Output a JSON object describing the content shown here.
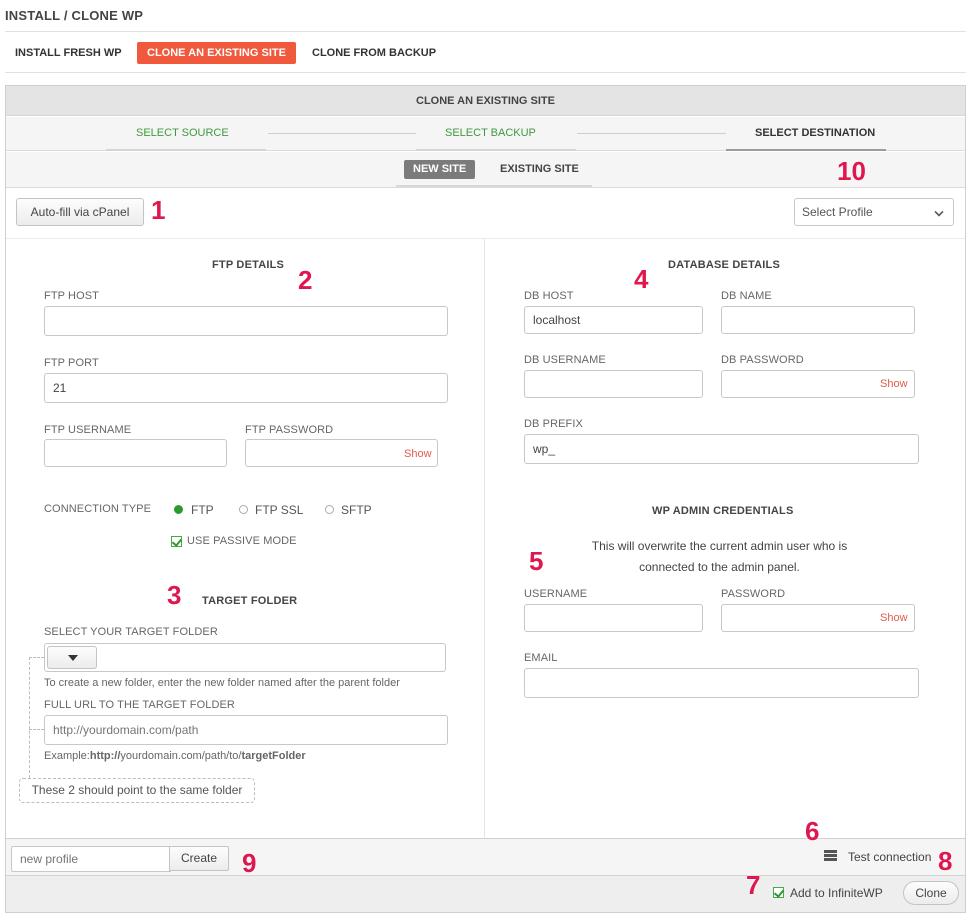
{
  "page_title": "INSTALL / CLONE WP",
  "top_tabs": [
    {
      "label": "INSTALL FRESH WP",
      "active": false
    },
    {
      "label": "CLONE AN EXISTING SITE",
      "active": true
    },
    {
      "label": "CLONE FROM BACKUP",
      "active": false
    }
  ],
  "panel_title": "CLONE AN EXISTING SITE",
  "steps": [
    {
      "label": "SELECT SOURCE",
      "state": "done"
    },
    {
      "label": "SELECT BACKUP",
      "state": "done"
    },
    {
      "label": "SELECT DESTINATION",
      "state": "current"
    }
  ],
  "sub_tabs": [
    {
      "label": "NEW SITE",
      "active": true
    },
    {
      "label": "EXISTING SITE",
      "active": false
    }
  ],
  "autofill_label": "Auto-fill via cPanel",
  "profile_select": "Select Profile",
  "ftp": {
    "heading": "FTP DETAILS",
    "host_label": "FTP HOST",
    "host_value": "",
    "port_label": "FTP PORT",
    "port_value": "21",
    "username_label": "FTP USERNAME",
    "username_value": "",
    "password_label": "FTP PASSWORD",
    "password_value": "",
    "show_label": "Show",
    "connection_label": "CONNECTION TYPE",
    "connection_options": [
      "FTP",
      "FTP SSL",
      "SFTP"
    ],
    "connection_selected": "FTP",
    "passive_label": "USE PASSIVE MODE",
    "passive_checked": true
  },
  "target": {
    "heading": "TARGET FOLDER",
    "select_label": "SELECT YOUR TARGET FOLDER",
    "folder_value": "",
    "folder_hint": "To create a new folder, enter the new folder named after the parent folder",
    "url_label": "FULL URL TO THE TARGET FOLDER",
    "url_placeholder": "http://yourdomain.com/path",
    "example_prefix": "Example:",
    "example_bold1": "http://",
    "example_mid": "yourdomain.com/path/to/",
    "example_bold2": "targetFolder",
    "same_folder_note": "These 2 should point to the same folder"
  },
  "db": {
    "heading": "DATABASE DETAILS",
    "host_label": "DB HOST",
    "host_value": "localhost",
    "name_label": "DB NAME",
    "name_value": "",
    "username_label": "DB USERNAME",
    "username_value": "",
    "password_label": "DB PASSWORD",
    "password_value": "",
    "show_label": "Show",
    "prefix_label": "DB PREFIX",
    "prefix_value": "wp_"
  },
  "admin": {
    "heading": "WP ADMIN CREDENTIALS",
    "note_line1": "This will overwrite the current admin user who is",
    "note_line2": "connected to the admin panel.",
    "username_label": "USERNAME",
    "username_value": "",
    "password_label": "PASSWORD",
    "password_value": "",
    "show_label": "Show",
    "email_label": "EMAIL",
    "email_value": ""
  },
  "footer": {
    "profile_placeholder": "new profile",
    "create_label": "Create",
    "test_connection_label": "Test connection",
    "add_label": "Add to InfiniteWP",
    "add_checked": true,
    "clone_label": "Clone"
  },
  "annotations": [
    "1",
    "2",
    "3",
    "4",
    "5",
    "6",
    "7",
    "8",
    "9",
    "10"
  ],
  "colors": {
    "accent": "#f0593b",
    "done_step": "#3e9a3e",
    "annotation": "#e0174f",
    "show_link": "#e05b4a"
  }
}
